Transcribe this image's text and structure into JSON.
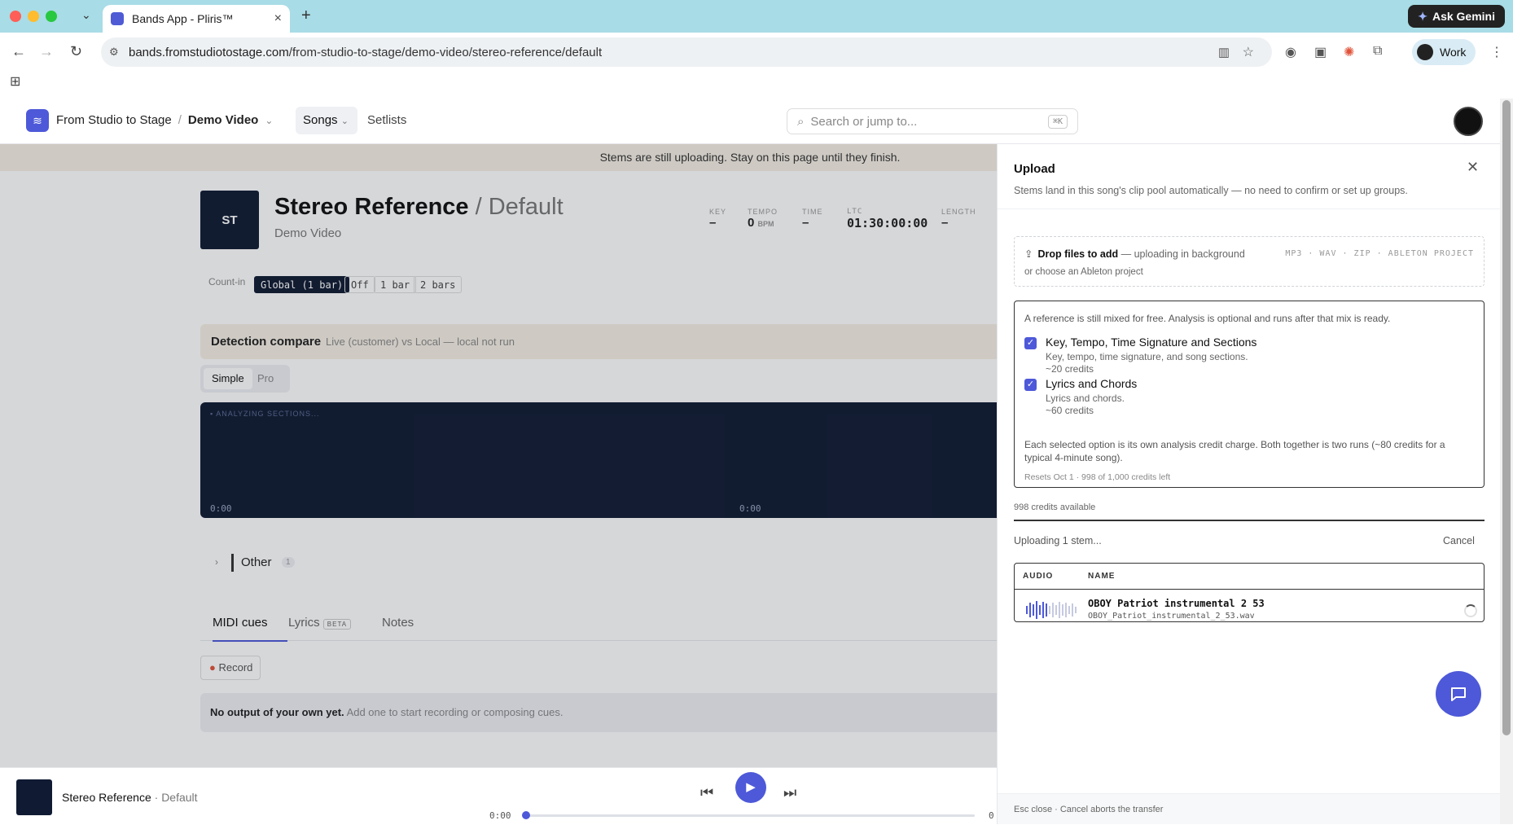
{
  "browser": {
    "tab_title": "Bands App - Pliris™",
    "url_host": "bands.fromstudiotostage.com",
    "url_path": "/from-studio-to-stage/demo-video/stereo-reference/default",
    "ask_gemini": "Ask Gemini",
    "profile": "Work"
  },
  "header": {
    "org": "From Studio to Stage",
    "separator": "/",
    "project": "Demo Video",
    "nav_songs": "Songs",
    "nav_setlists": "Setlists",
    "search_placeholder": "Search or jump to...",
    "search_shortcut": "⌘K"
  },
  "banner": "Stems are still uploading. Stay on this page until they finish.",
  "song": {
    "artwork_initials": "ST",
    "title": "Stereo Reference",
    "version": "/ Default",
    "project": "Demo Video",
    "meta": [
      {
        "label": "KEY",
        "value": "–",
        "unit": ""
      },
      {
        "label": "TEMPO",
        "value": "0",
        "unit": "BPM"
      },
      {
        "label": "TIME",
        "value": "–",
        "unit": ""
      },
      {
        "label": "LTC",
        "value": "01:30:00:00",
        "unit": ""
      },
      {
        "label": "LENGTH",
        "value": "–",
        "unit": ""
      }
    ],
    "countin_label": "Count-in",
    "countin_options": [
      "Global (1 bar)",
      "Off",
      "1 bar",
      "2 bars"
    ]
  },
  "detection": {
    "title": "Detection compare",
    "note": "Live (customer) vs Local — local not run",
    "modes": [
      "Simple",
      "Pro"
    ]
  },
  "waveform": {
    "status": "ANALYZING SECTIONS...",
    "time_start": "0:00",
    "time_mid": "0:00"
  },
  "group": {
    "name": "Other",
    "count": "1"
  },
  "bottom_tabs": {
    "midi": "MIDI cues",
    "lyrics": "Lyrics",
    "beta": "BETA",
    "notes": "Notes"
  },
  "record_label": "Record",
  "no_output": {
    "bold": "No output of your own yet.",
    "rest": "Add one to start recording or composing cues."
  },
  "panel": {
    "title": "Upload",
    "description": "Stems land in this song's clip pool automatically — no need to confirm or set up groups.",
    "drop_bold": "Drop files to add",
    "drop_rest": "— uploading in background",
    "drop_alt": "or choose an Ableton project",
    "formats": "MP3 · WAV · ZIP · ABLETON PROJECT",
    "analysis_intro": "A reference is still mixed for free. Analysis is optional and runs after that mix is ready.",
    "options": [
      {
        "name": "Key, Tempo, Time Signature and Sections",
        "desc": "Key, tempo, time signature, and song sections.",
        "cost": "~20 credits"
      },
      {
        "name": "Lyrics and Chords",
        "desc": "Lyrics and chords.",
        "cost": "~60 credits"
      }
    ],
    "footnote": "Each selected option is its own analysis credit charge. Both together is two runs (~80 credits for a typical 4-minute song).",
    "resets": "Resets Oct 1 · 998 of 1,000 credits left",
    "available": "998 credits available",
    "uploading": "Uploading 1 stem...",
    "cancel": "Cancel",
    "col_audio": "AUDIO",
    "col_name": "NAME",
    "stem_title": "OBOY Patriot instrumental 2 53",
    "stem_file": "OBOY_Patriot_instrumental_2_53.wav",
    "footer": "Esc close · Cancel aborts the transfer"
  },
  "player": {
    "title": "Stereo Reference",
    "version": "Default",
    "time_start": "0:00",
    "time_end": "0"
  },
  "colors": {
    "accent": "#4d59d8",
    "navy": "#101b33",
    "banner": "#f6efe4"
  }
}
